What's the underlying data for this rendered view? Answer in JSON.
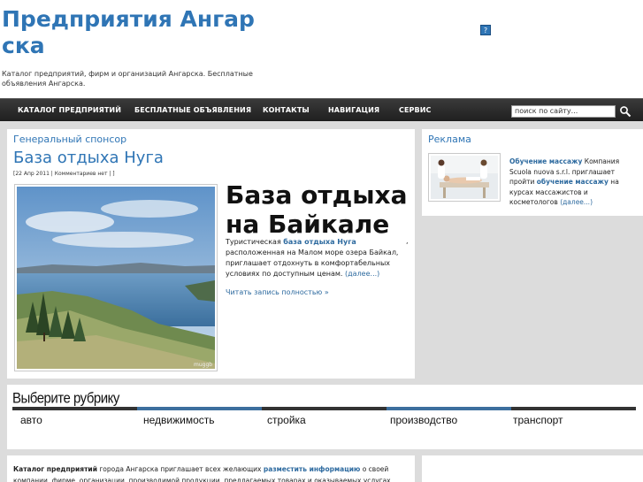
{
  "header": {
    "site_title": "Предприятия Ангарска",
    "description": "Каталог предприятий, фирм и организаций Ангарска. Бесплатные объявления Ангарска.",
    "badge": "?"
  },
  "nav": {
    "items": [
      "КАТАЛОГ ПРЕДПРИЯТИЙ",
      "БЕСПЛАТНЫЕ ОБЪЯВЛЕНИЯ",
      "КОНТАКТЫ",
      "НАВИГАЦИЯ",
      "СЕРВИС"
    ],
    "search_value": "поиск по сайту..."
  },
  "sponsor": {
    "heading": "Генеральный спонсор",
    "post_title": "База отдыха Нуга",
    "meta": "[22 Апр 2011 | Комментариев нет | ]",
    "promo_title": "База отдыха на Байкале",
    "text_before": "Туристическая ",
    "text_link": "база отдыха Нуга",
    "comma": ",",
    "text_after": " расположенная на Малом море озера Байкал, приглашает отдохнуть в комфортабельных условиях по доступным ценам. ",
    "more_link": "(далее...)",
    "read_full": "Читать запись полностью »"
  },
  "ad": {
    "heading": "Реклама",
    "link1": "Обучение массажу",
    "text1": " Компания Scuola nuova s.r.l. приглашает пройти ",
    "link2": "обучение массажу",
    "text2": " на курсах массажистов и косметологов ",
    "more_link": "(далее...)"
  },
  "rubric": {
    "heading": "Выберите рубрику",
    "items": [
      "авто",
      "недвижимость",
      "стройка",
      "производство",
      "транспорт"
    ],
    "bar_colors": [
      "#333333",
      "#3d6f9e",
      "#333333",
      "#3d6f9e",
      "#333333"
    ]
  },
  "footer_text": {
    "bold": "Каталог предприятий",
    "part1": " города Ангарска приглашает всех желающих ",
    "link": "разместить информацию",
    "part2": " о своей компании, фирме, организации, производимой продукции, предлагаемых товарах и оказываемых услугах."
  },
  "colors": {
    "accent": "#2f75b5",
    "nav_bg": "#2a2a2a",
    "page_bg": "#dcdcdc"
  }
}
